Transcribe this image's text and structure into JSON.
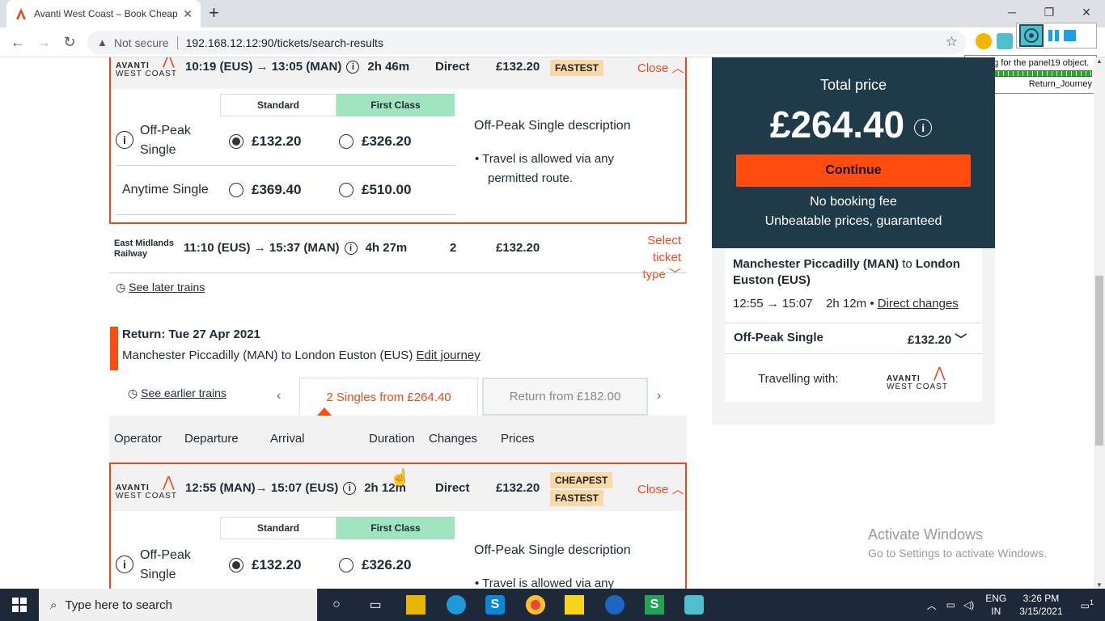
{
  "browser": {
    "tab_title": "Avanti West Coast – Book Cheap",
    "tab_close": "✕",
    "new_tab": "+",
    "url_warning": "Not secure",
    "url": "192.168.12.12:90/tickets/search-results",
    "minimize": "─",
    "maximize": "❐",
    "close": "✕"
  },
  "uipath_tooltip": {
    "message": "Waiting for the panel19 object.",
    "label": "Return_Journey"
  },
  "outbound_selected": {
    "operator": "AVANTI",
    "operator_line2": "WEST COAST",
    "times": "10:19 (EUS)  → 13:05 (MAN)",
    "duration": "2h 46m",
    "changes": "Direct",
    "price": "£132.20",
    "badge": "FASTEST",
    "close": "Close"
  },
  "outbound_fares": {
    "class_standard": "Standard",
    "class_first": "First Class",
    "offpeak_label_1": "Off-Peak",
    "offpeak_label_2": "Single",
    "offpeak_std": "£132.20",
    "offpeak_first": "£326.20",
    "anytime_label": "Anytime Single",
    "anytime_std": "£369.40",
    "anytime_first": "£510.00",
    "desc_title": "Off-Peak Single description",
    "desc_item_1": "Travel is allowed via any",
    "desc_item_2": "permitted route."
  },
  "outbound_other": {
    "operator_1": "East Midlands",
    "operator_2": "Railway",
    "times": "11:10 (EUS)  → 15:37 (MAN)",
    "duration": "4h 27m",
    "changes": "2",
    "price": "£132.20",
    "select_1": "Select ticket",
    "select_2": "type"
  },
  "see_later": "See later trains",
  "return": {
    "heading": "Return: Tue 27 Apr 2021",
    "route": "Manchester Piccadilly (MAN) to London Euston (EUS)",
    "edit": "Edit journey",
    "see_earlier": "See earlier trains",
    "tab_singles": "2 Singles from  £264.40",
    "tab_return": "Return from  £182.00",
    "columns": [
      "Operator",
      "Departure",
      "Arrival",
      "Duration",
      "Changes",
      "Prices"
    ]
  },
  "return_selected": {
    "operator": "AVANTI",
    "operator_line2": "WEST COAST",
    "times": "12:55 (MAN)→ 15:07 (EUS)",
    "duration": "2h 12m",
    "changes": "Direct",
    "price": "£132.20",
    "badge_1": "CHEAPEST",
    "badge_2": "FASTEST",
    "close": "Close",
    "class_standard": "Standard",
    "class_first": "First Class",
    "offpeak_label_1": "Off-Peak",
    "offpeak_label_2": "Single",
    "offpeak_std": "£132.20",
    "offpeak_first": "£326.20",
    "desc_title": "Off-Peak Single description",
    "desc_item_1": "Travel is allowed via any"
  },
  "sidebar": {
    "total_label": "Total price",
    "total": "£264.40",
    "continue": "Continue",
    "no_fee": "No booking fee",
    "guarantee": "Unbeatable prices, guaranteed",
    "route_from": "Manchester Piccadilly (MAN)",
    "route_to_word": "to",
    "route_to": "London",
    "route_to_2": "Euston (EUS)",
    "times": "12:55 → 15:07",
    "duration": "2h 12m",
    "bullet": "•",
    "direct_changes": "Direct changes",
    "fare": "Off-Peak Single",
    "fare_price": "£132.20",
    "travelling_with": "Travelling with:",
    "operator": "AVANTI",
    "operator_line2": "WEST COAST"
  },
  "activate": {
    "title": "Activate Windows",
    "sub": "Go to Settings to activate Windows."
  },
  "taskbar": {
    "search": "Type here to search",
    "lang_1": "ENG",
    "lang_2": "IN",
    "time": "3:26 PM",
    "date": "3/15/2021",
    "notif_count": "1"
  },
  "colors": {
    "accent": "#e7491e",
    "sidebar_bg": "#1f3b4a",
    "continue_bg": "#ff4c0f",
    "first_class_bg": "#9fe3bf",
    "badge_bg": "#f9d9a7"
  }
}
